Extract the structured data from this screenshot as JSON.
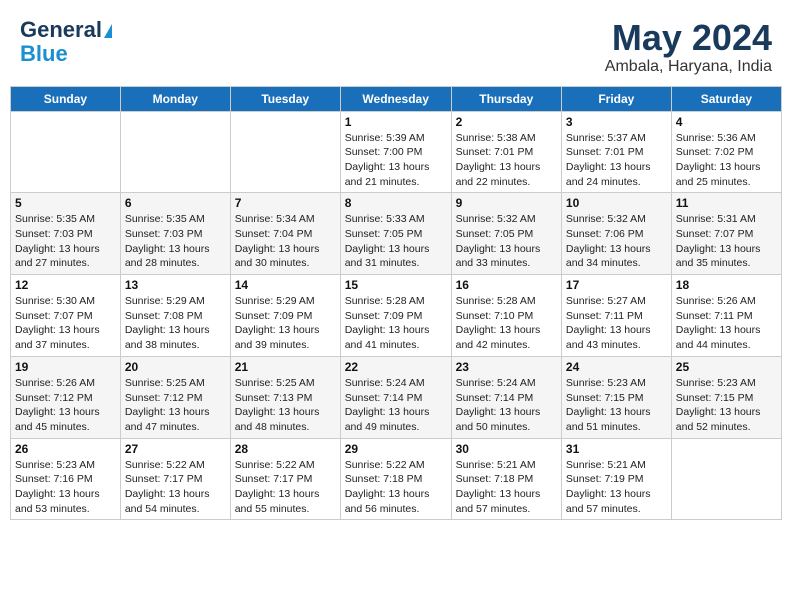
{
  "header": {
    "logo_line1": "General",
    "logo_line2": "Blue",
    "title": "May 2024",
    "subtitle": "Ambala, Haryana, India"
  },
  "days_of_week": [
    "Sunday",
    "Monday",
    "Tuesday",
    "Wednesday",
    "Thursday",
    "Friday",
    "Saturday"
  ],
  "weeks": [
    [
      {
        "day": "",
        "info": ""
      },
      {
        "day": "",
        "info": ""
      },
      {
        "day": "",
        "info": ""
      },
      {
        "day": "1",
        "info": "Sunrise: 5:39 AM\nSunset: 7:00 PM\nDaylight: 13 hours and 21 minutes."
      },
      {
        "day": "2",
        "info": "Sunrise: 5:38 AM\nSunset: 7:01 PM\nDaylight: 13 hours and 22 minutes."
      },
      {
        "day": "3",
        "info": "Sunrise: 5:37 AM\nSunset: 7:01 PM\nDaylight: 13 hours and 24 minutes."
      },
      {
        "day": "4",
        "info": "Sunrise: 5:36 AM\nSunset: 7:02 PM\nDaylight: 13 hours and 25 minutes."
      }
    ],
    [
      {
        "day": "5",
        "info": "Sunrise: 5:35 AM\nSunset: 7:03 PM\nDaylight: 13 hours and 27 minutes."
      },
      {
        "day": "6",
        "info": "Sunrise: 5:35 AM\nSunset: 7:03 PM\nDaylight: 13 hours and 28 minutes."
      },
      {
        "day": "7",
        "info": "Sunrise: 5:34 AM\nSunset: 7:04 PM\nDaylight: 13 hours and 30 minutes."
      },
      {
        "day": "8",
        "info": "Sunrise: 5:33 AM\nSunset: 7:05 PM\nDaylight: 13 hours and 31 minutes."
      },
      {
        "day": "9",
        "info": "Sunrise: 5:32 AM\nSunset: 7:05 PM\nDaylight: 13 hours and 33 minutes."
      },
      {
        "day": "10",
        "info": "Sunrise: 5:32 AM\nSunset: 7:06 PM\nDaylight: 13 hours and 34 minutes."
      },
      {
        "day": "11",
        "info": "Sunrise: 5:31 AM\nSunset: 7:07 PM\nDaylight: 13 hours and 35 minutes."
      }
    ],
    [
      {
        "day": "12",
        "info": "Sunrise: 5:30 AM\nSunset: 7:07 PM\nDaylight: 13 hours and 37 minutes."
      },
      {
        "day": "13",
        "info": "Sunrise: 5:29 AM\nSunset: 7:08 PM\nDaylight: 13 hours and 38 minutes."
      },
      {
        "day": "14",
        "info": "Sunrise: 5:29 AM\nSunset: 7:09 PM\nDaylight: 13 hours and 39 minutes."
      },
      {
        "day": "15",
        "info": "Sunrise: 5:28 AM\nSunset: 7:09 PM\nDaylight: 13 hours and 41 minutes."
      },
      {
        "day": "16",
        "info": "Sunrise: 5:28 AM\nSunset: 7:10 PM\nDaylight: 13 hours and 42 minutes."
      },
      {
        "day": "17",
        "info": "Sunrise: 5:27 AM\nSunset: 7:11 PM\nDaylight: 13 hours and 43 minutes."
      },
      {
        "day": "18",
        "info": "Sunrise: 5:26 AM\nSunset: 7:11 PM\nDaylight: 13 hours and 44 minutes."
      }
    ],
    [
      {
        "day": "19",
        "info": "Sunrise: 5:26 AM\nSunset: 7:12 PM\nDaylight: 13 hours and 45 minutes."
      },
      {
        "day": "20",
        "info": "Sunrise: 5:25 AM\nSunset: 7:12 PM\nDaylight: 13 hours and 47 minutes."
      },
      {
        "day": "21",
        "info": "Sunrise: 5:25 AM\nSunset: 7:13 PM\nDaylight: 13 hours and 48 minutes."
      },
      {
        "day": "22",
        "info": "Sunrise: 5:24 AM\nSunset: 7:14 PM\nDaylight: 13 hours and 49 minutes."
      },
      {
        "day": "23",
        "info": "Sunrise: 5:24 AM\nSunset: 7:14 PM\nDaylight: 13 hours and 50 minutes."
      },
      {
        "day": "24",
        "info": "Sunrise: 5:23 AM\nSunset: 7:15 PM\nDaylight: 13 hours and 51 minutes."
      },
      {
        "day": "25",
        "info": "Sunrise: 5:23 AM\nSunset: 7:15 PM\nDaylight: 13 hours and 52 minutes."
      }
    ],
    [
      {
        "day": "26",
        "info": "Sunrise: 5:23 AM\nSunset: 7:16 PM\nDaylight: 13 hours and 53 minutes."
      },
      {
        "day": "27",
        "info": "Sunrise: 5:22 AM\nSunset: 7:17 PM\nDaylight: 13 hours and 54 minutes."
      },
      {
        "day": "28",
        "info": "Sunrise: 5:22 AM\nSunset: 7:17 PM\nDaylight: 13 hours and 55 minutes."
      },
      {
        "day": "29",
        "info": "Sunrise: 5:22 AM\nSunset: 7:18 PM\nDaylight: 13 hours and 56 minutes."
      },
      {
        "day": "30",
        "info": "Sunrise: 5:21 AM\nSunset: 7:18 PM\nDaylight: 13 hours and 57 minutes."
      },
      {
        "day": "31",
        "info": "Sunrise: 5:21 AM\nSunset: 7:19 PM\nDaylight: 13 hours and 57 minutes."
      },
      {
        "day": "",
        "info": ""
      }
    ]
  ]
}
